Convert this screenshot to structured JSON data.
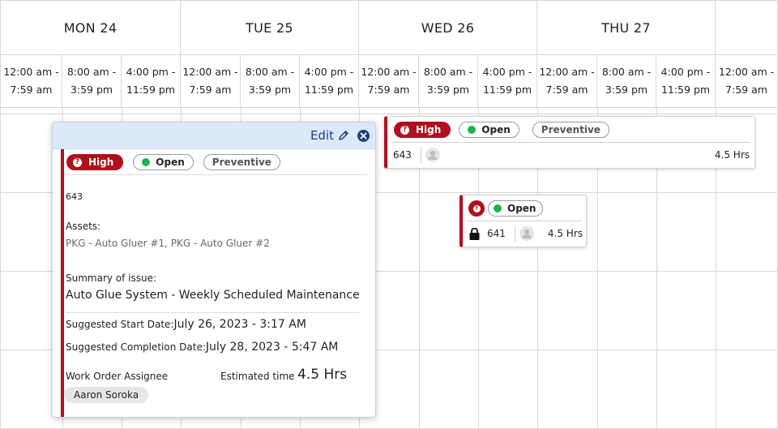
{
  "days": [
    {
      "label": "MON 24",
      "shifts": [
        [
          "12:00 am -",
          "7:59 am"
        ],
        [
          "8:00 am -",
          "3:59 pm"
        ],
        [
          "4:00 pm -",
          "11:59 pm"
        ]
      ]
    },
    {
      "label": "TUE 25",
      "shifts": [
        [
          "12:00 am -",
          "7:59 am"
        ],
        [
          "8:00 am -",
          "3:59 pm"
        ],
        [
          "4:00 pm -",
          "11:59 pm"
        ]
      ]
    },
    {
      "label": "WED 26",
      "shifts": [
        [
          "12:00 am -",
          "7:59 am"
        ],
        [
          "8:00 am -",
          "3:59 pm"
        ],
        [
          "4:00 pm -",
          "11:59 pm"
        ]
      ]
    },
    {
      "label": "THU 27",
      "shifts": [
        [
          "12:00 am -",
          "7:59 am"
        ],
        [
          "8:00 am -",
          "3:59 pm"
        ],
        [
          "4:00 pm -",
          "11:59 pm"
        ]
      ]
    },
    {
      "label": "",
      "shifts": [
        [
          "12:00 am -",
          "7:59 am"
        ]
      ]
    }
  ],
  "card1": {
    "priority": "High",
    "status": "Open",
    "type": "Preventive",
    "id": "643",
    "hours": "4.5 Hrs"
  },
  "card2": {
    "status": "Open",
    "id": "641",
    "hours": "4.5 Hrs"
  },
  "popover": {
    "edit_label": "Edit",
    "priority": "High",
    "status": "Open",
    "type": "Preventive",
    "id": "643",
    "assets_label": "Assets:",
    "assets_value": "PKG - Auto Gluer #1, PKG - Auto Gluer #2",
    "summary_label": "Summary of issue:",
    "summary_value": "Auto Glue System - Weekly Scheduled Maintenance",
    "start_label": "Suggested Start Date:",
    "start_value": "July 26, 2023 - 3:17 AM",
    "completion_label": "Suggested Completion Date:",
    "completion_value": "July 28, 2023 - 5:47 AM",
    "assignee_label": "Work Order Assignee",
    "assignee_value": "Aaron Soroka",
    "estimated_label": "Estimated time",
    "estimated_value": "4.5 Hrs"
  },
  "colors": {
    "priority_high": "#b0101e",
    "status_open": "#22b24c",
    "popover_header": "#dce9f9",
    "edit_blue": "#1f3f7a"
  }
}
